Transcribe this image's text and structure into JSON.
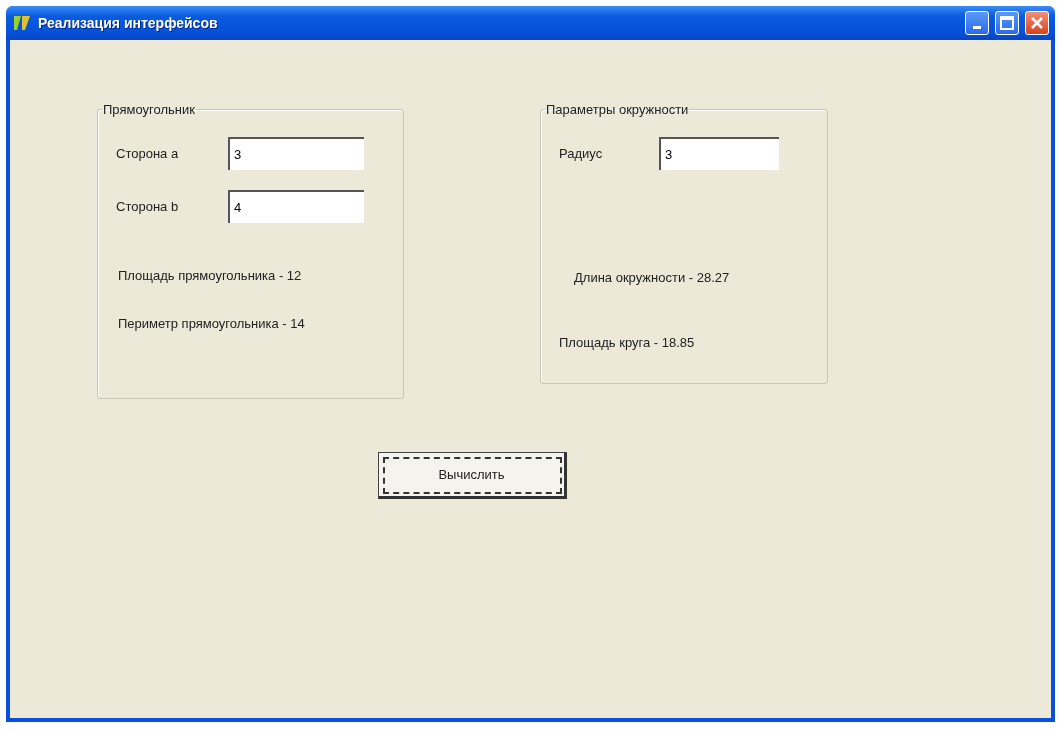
{
  "window": {
    "title": "Реализация интерфейсов"
  },
  "groups": [
    {
      "title": "Прямоугольник",
      "fields": [
        {
          "label": "Сторона a",
          "value": "3"
        },
        {
          "label": "Сторона b",
          "value": "4"
        }
      ],
      "results": [
        "Площадь прямоугольника - 12",
        "Периметр прямоугольника - 14"
      ]
    },
    {
      "title": "Параметры окружности",
      "fields": [
        {
          "label": "Радиус",
          "value": "3"
        }
      ],
      "results": [
        "Длина окружности - 28.27",
        "Площадь круга - 18.85"
      ]
    }
  ],
  "button": {
    "label": "Вычислить",
    "focused": true
  }
}
